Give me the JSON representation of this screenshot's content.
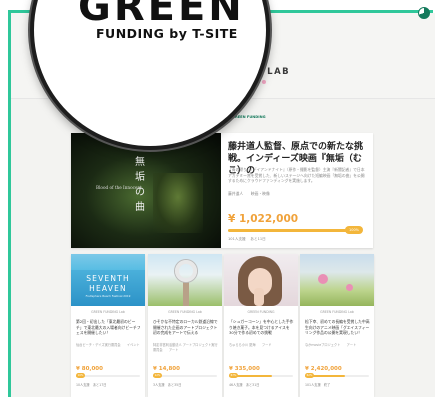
{
  "lens": {
    "big_text": "GREEN",
    "sub_text": "FUNDING by T-SITE"
  },
  "header": {
    "lab_title": "N FUNDING LAB"
  },
  "powered": {
    "text": "powered by",
    "brand": "GREEN FUNDING"
  },
  "feature": {
    "image_text_vertical": [
      "無",
      "垢",
      "の",
      "曲"
    ],
    "image_text_en": "Blood of the Innocent",
    "title": "藤井道人監督、原点での新たな挑戦。インディーズ映画『無垢（むこ）の",
    "description": "『青の帰り』『デイアンドナイト』（原作・撮影を監督）主演『新聞記者』で日本アカデミー賞を受賞した、新しいステージへ向けた短編映画「無垢の曲」を公開するためにクラウドファンディングを実施します。",
    "meta": "藤井道人　　映画・映像",
    "amount": "¥ 1,022,000",
    "progress": 100,
    "pct_label": "100%",
    "backers": "101人支援",
    "days_left": "あと11日"
  },
  "cards": [
    {
      "lab": "GREEN FUNDING Lab",
      "image": {
        "line1": "SEVENTH",
        "line2": "HEAVEN",
        "line3": "Fruitsphere Beach Festival 2019"
      },
      "title": "第2回・初出した「東北最初のビーチ」で東北最大の入場者向けビーチフェスを開催したい！",
      "org": "仙台ビーチ・デイズ実行委員会　　イベント",
      "amount": "¥ 80,000",
      "progress": 10,
      "pct_label": "10%",
      "backers": "10人支援",
      "days_left": "あと17日"
    },
    {
      "lab": "GREEN FUNDING Lab",
      "title": "ひそかな不特定のローカル鉄道沿線で開催された企画のアートプロジェクト初の完成をアートで伝える",
      "org": "特定非営利活動法人 アートプロジェクト実行委員会　　アート",
      "amount": "¥ 14,800",
      "progress": 12,
      "pct_label": "12%",
      "backers": "3人支援",
      "days_left": "あと35日"
    },
    {
      "lab": "GREEN FUNDING",
      "title": "「シュガーコーン」を中心とした手作り焼き菓子。本を見つけるアイスを30分で作る初めての挑戦",
      "org": "ちゅらら小川 夏海　　フード",
      "amount": "¥ 335,000",
      "progress": 67,
      "pct_label": "67%",
      "backers": "46人支援",
      "days_left": "あと31日"
    },
    {
      "lab": "GREEN FUNDING Lab",
      "title": "松下幸、初めての長編を受賞した中高生向けのアニメ映画「グエイスフィーリング作品の公開を実現したい！",
      "org": "なかmovieプロジェクト　　アート",
      "amount": "¥ 2,420,000",
      "progress": 62,
      "pct_label": "62%",
      "backers": "101人支援",
      "days_left": "終了"
    }
  ]
}
